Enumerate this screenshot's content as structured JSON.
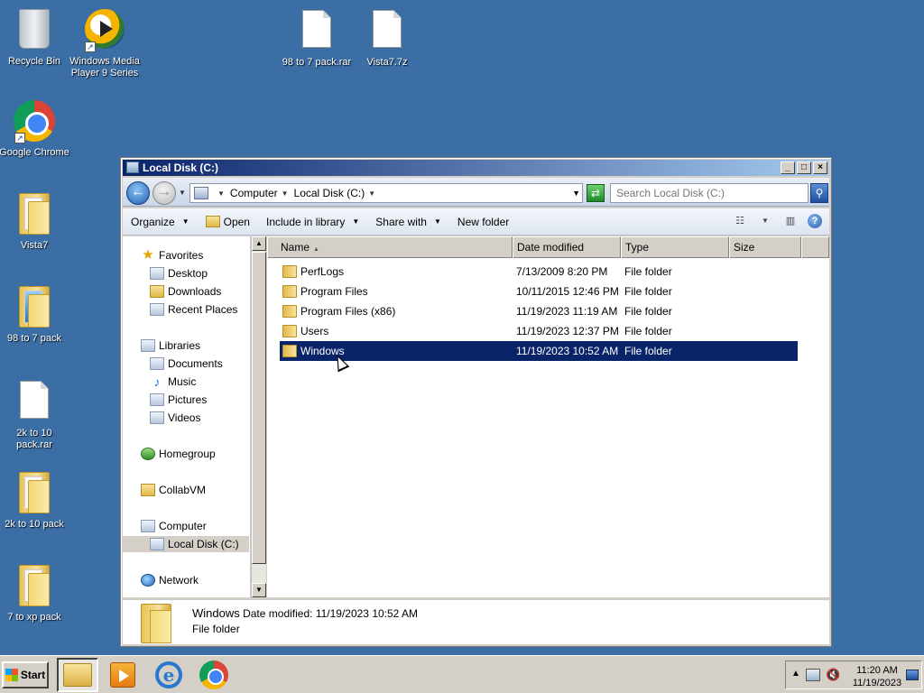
{
  "desktop": {
    "icons": [
      {
        "label": "Recycle Bin"
      },
      {
        "label": "Windows Media Player 9 Series"
      },
      {
        "label": "98 to 7 pack.rar"
      },
      {
        "label": "Vista7.7z"
      },
      {
        "label": "Google Chrome"
      },
      {
        "label": "Vista7"
      },
      {
        "label": "98 to 7 pack"
      },
      {
        "label": "2k to 10 pack.rar"
      },
      {
        "label": "2k to 10 pack"
      },
      {
        "label": "7 to xp pack"
      }
    ]
  },
  "window": {
    "title": "Local Disk (C:)",
    "buttons": {
      "minimize": "_",
      "maximize": "□",
      "close": "×"
    },
    "breadcrumb": [
      "Computer",
      "Local Disk (C:)"
    ],
    "search_placeholder": "Search Local Disk (C:)",
    "commands": {
      "organize": "Organize",
      "open": "Open",
      "include": "Include in library",
      "share": "Share with",
      "new_folder": "New folder"
    },
    "nav": {
      "favorites": "Favorites",
      "desktop": "Desktop",
      "downloads": "Downloads",
      "recent": "Recent Places",
      "libraries": "Libraries",
      "documents": "Documents",
      "music": "Music",
      "pictures": "Pictures",
      "videos": "Videos",
      "homegroup": "Homegroup",
      "collabvm": "CollabVM",
      "computer": "Computer",
      "localdisk": "Local Disk (C:)",
      "network": "Network"
    },
    "columns": {
      "name": "Name",
      "date": "Date modified",
      "type": "Type",
      "size": "Size"
    },
    "files": [
      {
        "name": "PerfLogs",
        "date": "7/13/2009 8:20 PM",
        "type": "File folder"
      },
      {
        "name": "Program Files",
        "date": "10/11/2015 12:46 PM",
        "type": "File folder"
      },
      {
        "name": "Program Files (x86)",
        "date": "11/19/2023 11:19 AM",
        "type": "File folder"
      },
      {
        "name": "Users",
        "date": "11/19/2023 12:37 PM",
        "type": "File folder"
      },
      {
        "name": "Windows",
        "date": "11/19/2023 10:52 AM",
        "type": "File folder"
      }
    ],
    "details": {
      "name": "Windows",
      "date_label": "Date modified:",
      "date_value": "11/19/2023 10:52 AM",
      "type": "File folder"
    }
  },
  "taskbar": {
    "start": "Start",
    "clock_time": "11:20 AM",
    "clock_date": "11/19/2023"
  },
  "colors": {
    "desktop": "#3a6ea5",
    "titlebar_start": "#0a246a",
    "titlebar_end": "#a6caf0",
    "selection": "#0a246a"
  }
}
